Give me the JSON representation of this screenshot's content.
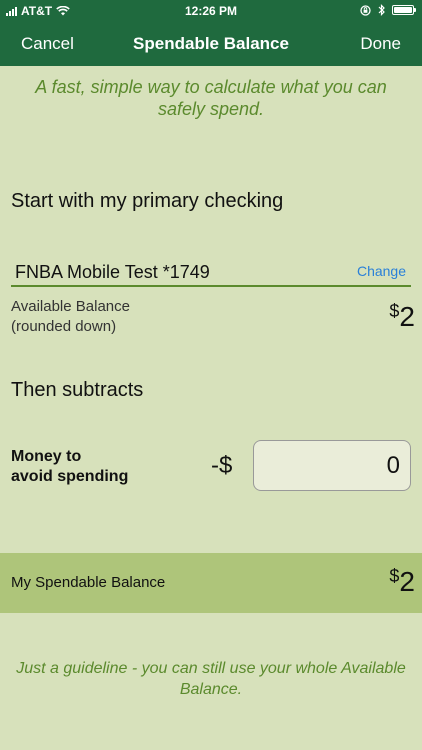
{
  "status_bar": {
    "carrier": "AT&T",
    "time": "12:26 PM"
  },
  "nav": {
    "cancel": "Cancel",
    "title": "Spendable Balance",
    "done": "Done"
  },
  "tagline": "A fast, simple way to calculate what you can safely spend.",
  "start_section": {
    "title": "Start with my primary checking",
    "account_name": "FNBA Mobile Test *1749",
    "change_label": "Change",
    "available_label_line1": "Available Balance",
    "available_label_line2": "(rounded down)",
    "available_currency": "$",
    "available_amount": "2"
  },
  "subtract_section": {
    "title": "Then subtracts",
    "money_label_line1": "Money to",
    "money_label_line2": "avoid spending",
    "prefix": "-$",
    "input_value": "0"
  },
  "result": {
    "label": "My Spendable Balance",
    "currency": "$",
    "amount": "2"
  },
  "guideline": "Just a guideline - you can still use your whole Available Balance.",
  "colors": {
    "nav_bg": "#1f6a3e",
    "page_bg": "#d7e1bb",
    "accent_green": "#5b8a2d",
    "result_bg": "#aec57a",
    "link_blue": "#2a80d8"
  }
}
